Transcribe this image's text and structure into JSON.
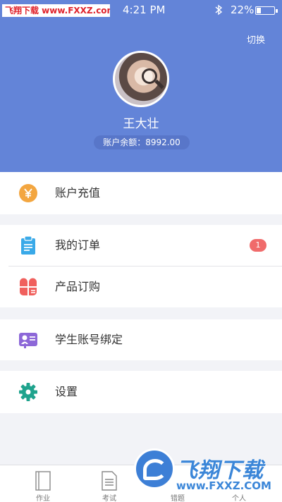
{
  "status_bar": {
    "watermark": "飞翔下载 www.FXXZ.com",
    "time": "4:21 PM",
    "battery": "22%",
    "battery_level": 0.22,
    "icons": [
      "bluetooth-icon",
      "battery-icon"
    ]
  },
  "header": {
    "switch_label": "切换",
    "user_name": "王大壮",
    "balance": "账户余额：8992.00",
    "background_color": "#6384d8"
  },
  "menu": {
    "recharge": {
      "label": "账户充值",
      "icon": "yen-coin-icon",
      "icon_color": "#f3a640"
    },
    "orders": {
      "label": "我的订单",
      "icon": "clipboard-icon",
      "icon_color": "#39a9e8",
      "badge": "1",
      "badge_color": "#f06b6b"
    },
    "products": {
      "label": "产品订购",
      "icon": "grid-petals-icon",
      "icon_color": "#f0605d"
    },
    "bind_student": {
      "label": "学生账号绑定",
      "icon": "id-card-icon",
      "icon_color": "#8d68d8"
    },
    "settings": {
      "label": "设置",
      "icon": "gear-icon",
      "icon_color": "#1fa38d"
    }
  },
  "tabbar": {
    "tabs": [
      {
        "label": "作业",
        "icon": "book-icon"
      },
      {
        "label": "考试",
        "icon": "document-icon"
      },
      {
        "label": "错题",
        "icon": "mistake-icon"
      },
      {
        "label": "个人",
        "icon": "person-icon"
      }
    ]
  },
  "watermark": {
    "brand": "飞翔下载",
    "url": "www.FXXZ.COM"
  }
}
